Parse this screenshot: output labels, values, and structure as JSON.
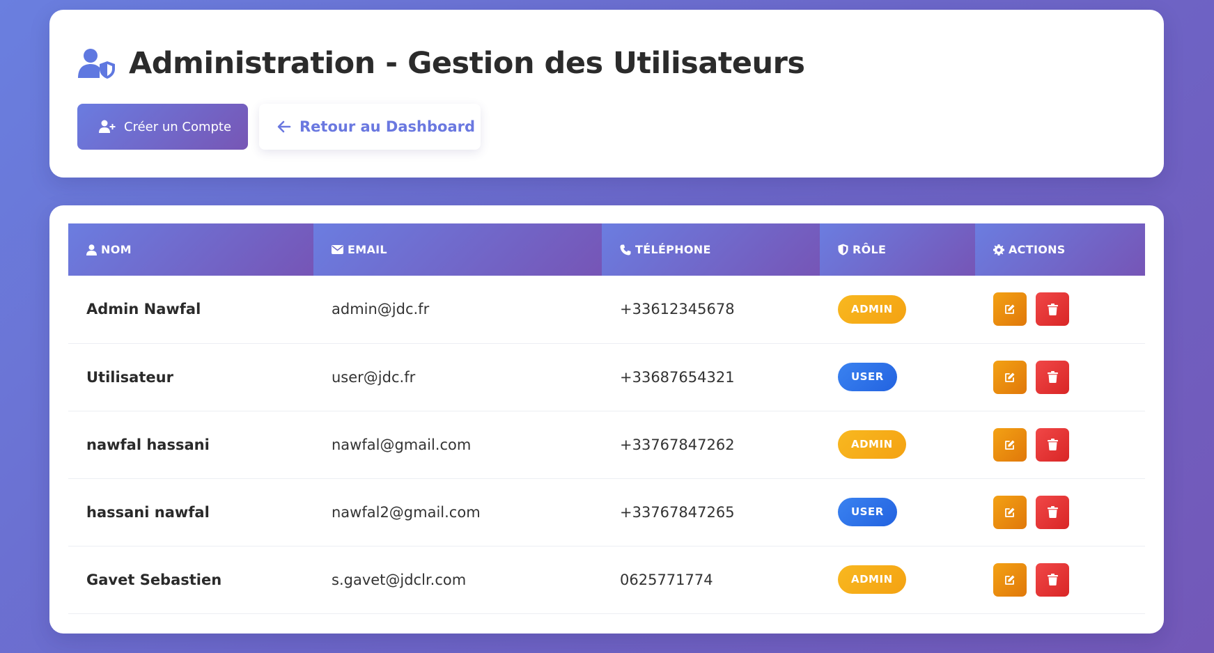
{
  "header": {
    "title": "Administration - Gestion des Utilisateurs",
    "title_icon": "user-shield-icon",
    "create_button_label": "Créer un Compte",
    "create_button_icon": "user-plus-icon",
    "back_button_label": "Retour au Dashboard",
    "back_button_icon": "arrow-left-icon"
  },
  "table": {
    "columns": [
      {
        "label": "NOM",
        "icon": "user-icon"
      },
      {
        "label": "EMAIL",
        "icon": "envelope-icon"
      },
      {
        "label": "TÉLÉPHONE",
        "icon": "phone-icon"
      },
      {
        "label": "RÔLE",
        "icon": "shield-icon"
      },
      {
        "label": "ACTIONS",
        "icon": "gear-icon"
      }
    ],
    "rows": [
      {
        "name": "Admin Nawfal",
        "email": "admin@jdc.fr",
        "phone": "+33612345678",
        "role": "ADMIN"
      },
      {
        "name": "Utilisateur",
        "email": "user@jdc.fr",
        "phone": "+33687654321",
        "role": "USER"
      },
      {
        "name": "nawfal hassani",
        "email": "nawfal@gmail.com",
        "phone": "+33767847262",
        "role": "ADMIN"
      },
      {
        "name": "hassani nawfal",
        "email": "nawfal2@gmail.com",
        "phone": "+33767847265",
        "role": "USER"
      },
      {
        "name": "Gavet Sebastien",
        "email": "s.gavet@jdclr.com",
        "phone": "0625771774",
        "role": "ADMIN"
      }
    ],
    "row_actions": {
      "edit_icon": "edit-icon",
      "delete_icon": "trash-icon"
    }
  },
  "colors": {
    "accent": "#6a78e0",
    "accent_dark": "#7655b6",
    "admin_badge": "#f6ad18",
    "user_badge": "#2e72e8",
    "edit_button": "#ea8c0f",
    "delete_button": "#e53636"
  }
}
